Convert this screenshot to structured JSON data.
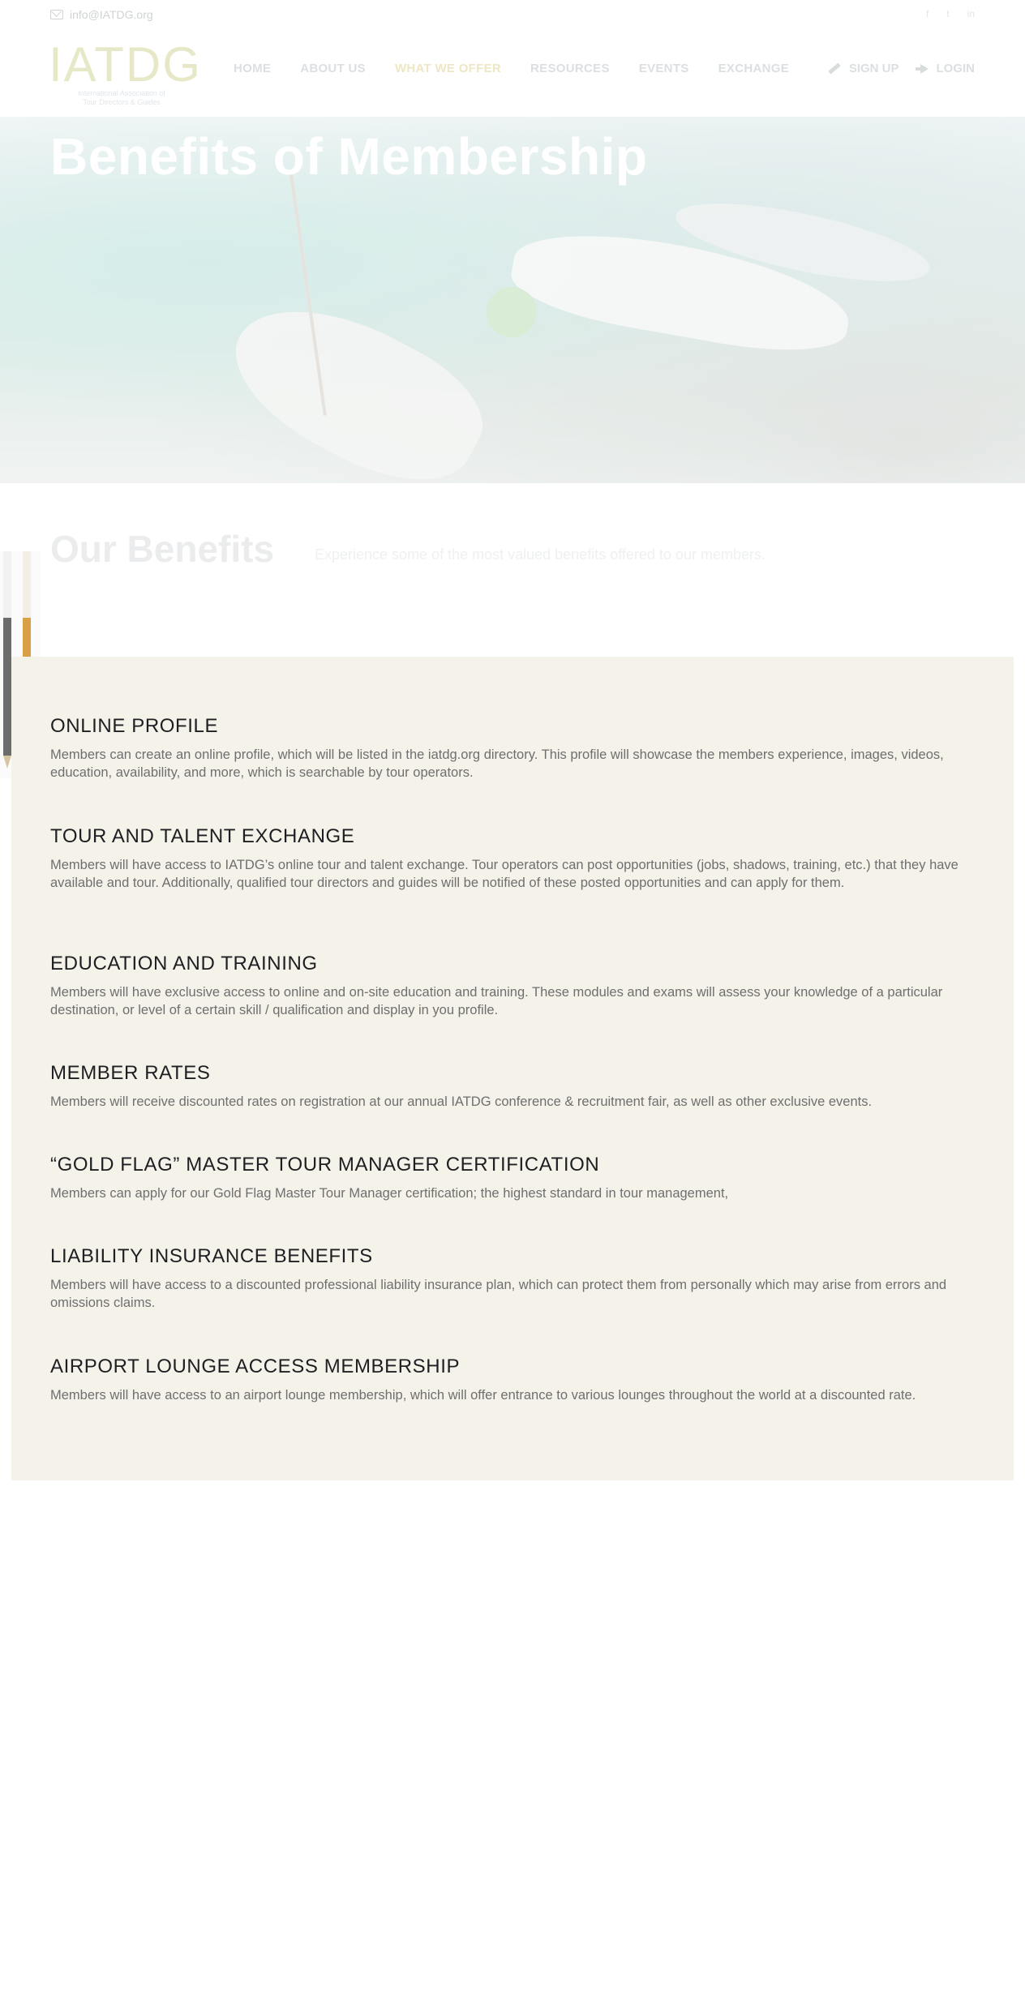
{
  "topbar": {
    "email": "info@IATDG.org",
    "social_icons": [
      "facebook-icon",
      "twitter-icon",
      "linkedin-icon"
    ]
  },
  "header": {
    "logo": {
      "mark": "IATDG",
      "tagline_line1": "International Association of",
      "tagline_line2": "Tour Directors & Guides"
    },
    "nav": [
      {
        "label": "HOME"
      },
      {
        "label": "ABOUT US"
      },
      {
        "label": "WHAT WE OFFER"
      },
      {
        "label": "RESOURCES"
      },
      {
        "label": "EVENTS"
      },
      {
        "label": "EXCHANGE"
      }
    ],
    "signup_label": "SIGN UP",
    "login_label": "LOGIN"
  },
  "hero": {
    "title": "Benefits of Membership"
  },
  "section": {
    "title": "Our Benefits",
    "subtitle": "Experience some of the most valued benefits offered to our members."
  },
  "benefits": [
    {
      "title": "ONLINE PROFILE",
      "text": "Members can create an online profile, which will be listed in the iatdg.org directory. This profile will showcase the members experience, images, videos, education, availability, and more, which is searchable by tour operators."
    },
    {
      "title": "TOUR AND TALENT EXCHANGE",
      "text": "Members will have access to IATDG’s online tour and talent exchange. Tour operators can post opportunities (jobs, shadows, training, etc.) that they have available and tour. Additionally, qualified tour directors and guides will be notified of these posted opportunities and can apply for them."
    },
    {
      "title": "EDUCATION AND TRAINING",
      "text": "Members will have exclusive access to online and on-site education and training. These modules and exams will assess your knowledge of a particular destination, or level of a certain skill / qualification and display in you profile."
    },
    {
      "title": "MEMBER RATES",
      "text": "Members will receive discounted rates on registration at our annual IATDG conference & recruitment fair, as well as other exclusive events."
    },
    {
      "title": "“GOLD FLAG” MASTER TOUR MANAGER CERTIFICATION",
      "text": "Members can apply for our Gold Flag Master Tour Manager certification; the highest standard in tour management,"
    },
    {
      "title": "LIABILITY INSURANCE BENEFITS",
      "text": "Members will have access to a discounted professional liability insurance plan, which can protect them from personally which may arise from errors and omissions claims."
    },
    {
      "title": "AIRPORT LOUNGE ACCESS MEMBERSHIP",
      "text": "Members will have access to an airport lounge membership, which will offer entrance to various lounges throughout the world at a discounted rate."
    }
  ]
}
